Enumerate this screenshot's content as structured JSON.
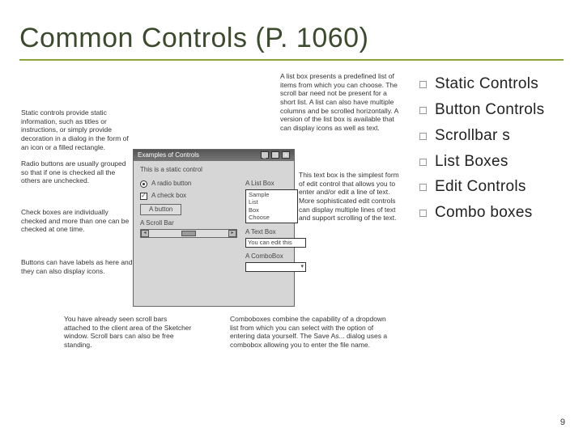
{
  "title": "Common Controls (P. 1060)",
  "bullets": [
    "Static Controls",
    "Button Controls",
    "Scrollbar s",
    "List Boxes",
    "Edit Controls",
    "Combo boxes"
  ],
  "page_number": "9",
  "annotations": {
    "top_right": "A list box presents a predefined list of items from which you can choose. The scroll bar need not be present for a short list. A list can also have multiple columns and be scrolled horizontally. A version of the list box is available that can display icons as well as text.",
    "left1": "Static controls provide static information, such as titles or instructions, or simply provide decoration in a dialog in the form of an icon or a filled rectangle.",
    "left2": "Radio buttons are usually grouped so that if one is checked all the others are unchecked.",
    "left3": "Check boxes are individually checked and more than one can be checked at one time.",
    "left4": "Buttons can have labels as here and they can also display icons.",
    "right1": "This text box is the simplest form of edit control that allows you to enter and/or edit a line of text. More sophisticated edit controls can display multiple lines of text and support scrolling of the text.",
    "bot_left": "You have already seen scroll bars attached to the client area of the Sketcher window. Scroll bars can also be free standing.",
    "bot_right": "Comboboxes combine the capability of a dropdown list from which you can select with the option of entering data yourself. The Save As... dialog uses a combobox allowing you to enter the file name."
  },
  "dialog": {
    "title": "Examples of Controls",
    "static_text": "This is a static control",
    "radio_label": "A radio button",
    "check_label": "A check box",
    "button_label": "A button",
    "scrollbar_label": "A Scroll Bar",
    "listbox_header": "A List Box",
    "listbox_items": [
      "Sample",
      "List",
      "Box",
      "Choose"
    ],
    "edit_header": "A Text Box",
    "edit_value": "You can edit this",
    "combo_header": "A ComboBox",
    "combo_value": ""
  }
}
